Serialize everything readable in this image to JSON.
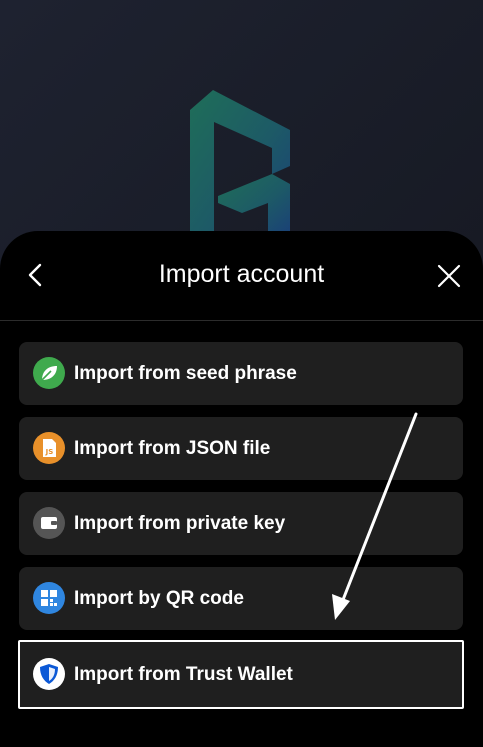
{
  "header": {
    "title": "Import account"
  },
  "options": [
    {
      "label": "Import from seed phrase",
      "icon": "leaf-icon"
    },
    {
      "label": "Import from JSON file",
      "icon": "json-file-icon",
      "icon_text": "JS"
    },
    {
      "label": "Import from private key",
      "icon": "wallet-icon"
    },
    {
      "label": "Import by QR code",
      "icon": "qr-code-icon"
    },
    {
      "label": "Import from Trust Wallet",
      "icon": "trust-wallet-shield-icon",
      "selected": true
    }
  ],
  "colors": {
    "sheet": "#000000",
    "option_bg": "#1f1f1f",
    "seed_icon": "#3faa4d",
    "json_icon": "#e8902a",
    "key_icon": "#555555",
    "qr_icon": "#2f86e0",
    "trust_icon": "#0b58d6",
    "highlight": "#ffffff"
  }
}
